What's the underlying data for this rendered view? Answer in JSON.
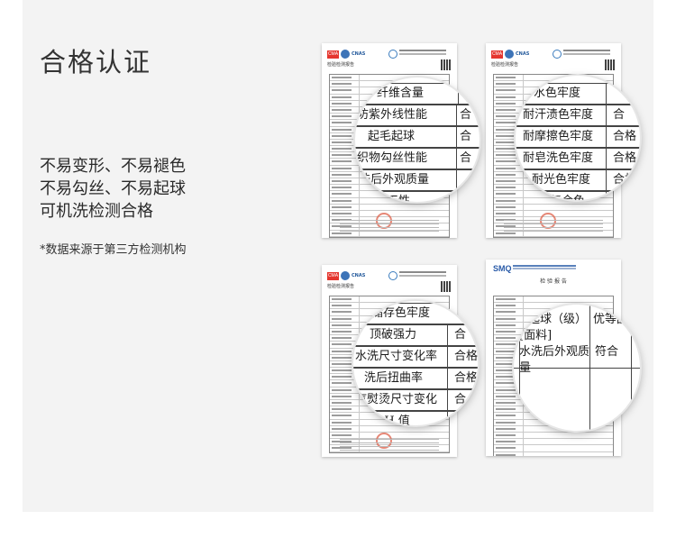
{
  "section": {
    "title": "合格认证",
    "features": [
      "不易变形、不易褪色",
      "不易勾丝、不易起球",
      "可机洗检测合格"
    ],
    "note": "*数据来源于第三方检测机构"
  },
  "reports": [
    {
      "org_logos": [
        "CMA",
        "ilac-MRA",
        "CNAS"
      ],
      "title": "检验检测报告",
      "magnified": [
        {
          "label": "纤维含量",
          "result": ""
        },
        {
          "label": "防紫外线性能",
          "result": "合"
        },
        {
          "label": "起毛起球",
          "result": "合"
        },
        {
          "label": "织物勾丝性能",
          "result": "合"
        },
        {
          "label": "洗后外观质量",
          "result": ""
        },
        {
          "label": "速干性",
          "result": ""
        }
      ]
    },
    {
      "org_logos": [
        "CMA",
        "ilac-MRA",
        "CNAS"
      ],
      "title": "检验检测报告",
      "magnified": [
        {
          "label": "水色牢度",
          "result": ""
        },
        {
          "label": "耐汗渍色牢度",
          "result": "合"
        },
        {
          "label": "耐摩擦色牢度",
          "result": "合格"
        },
        {
          "label": "耐皂洗色牢度",
          "result": "合格"
        },
        {
          "label": "耐光色牢度",
          "result": "合格"
        },
        {
          "label": "、汗复合色",
          "result": "合"
        }
      ]
    },
    {
      "org_logos": [
        "CMA",
        "ilac-MRA",
        "CNAS"
      ],
      "title": "检验检测报告",
      "magnified": [
        {
          "label": "储存色牢度",
          "result": ""
        },
        {
          "label": "顶破强力",
          "result": "合"
        },
        {
          "label": "水洗尺寸变化率",
          "result": "合格"
        },
        {
          "label": "洗后扭曲率",
          "result": "合格"
        },
        {
          "label": "汽熨烫尺寸变化",
          "result": "合"
        },
        {
          "label": "pH 值",
          "result": ""
        }
      ]
    },
    {
      "org_logos": [
        "SMQ"
      ],
      "title": "检 验 报 告",
      "magnified": [
        {
          "label": "起球（级）",
          "result": "优等品"
        },
        {
          "label": "[面料]",
          "result": ""
        },
        {
          "label": "水洗后外观质",
          "result": "符合"
        },
        {
          "label": "量",
          "result": ""
        }
      ]
    }
  ]
}
